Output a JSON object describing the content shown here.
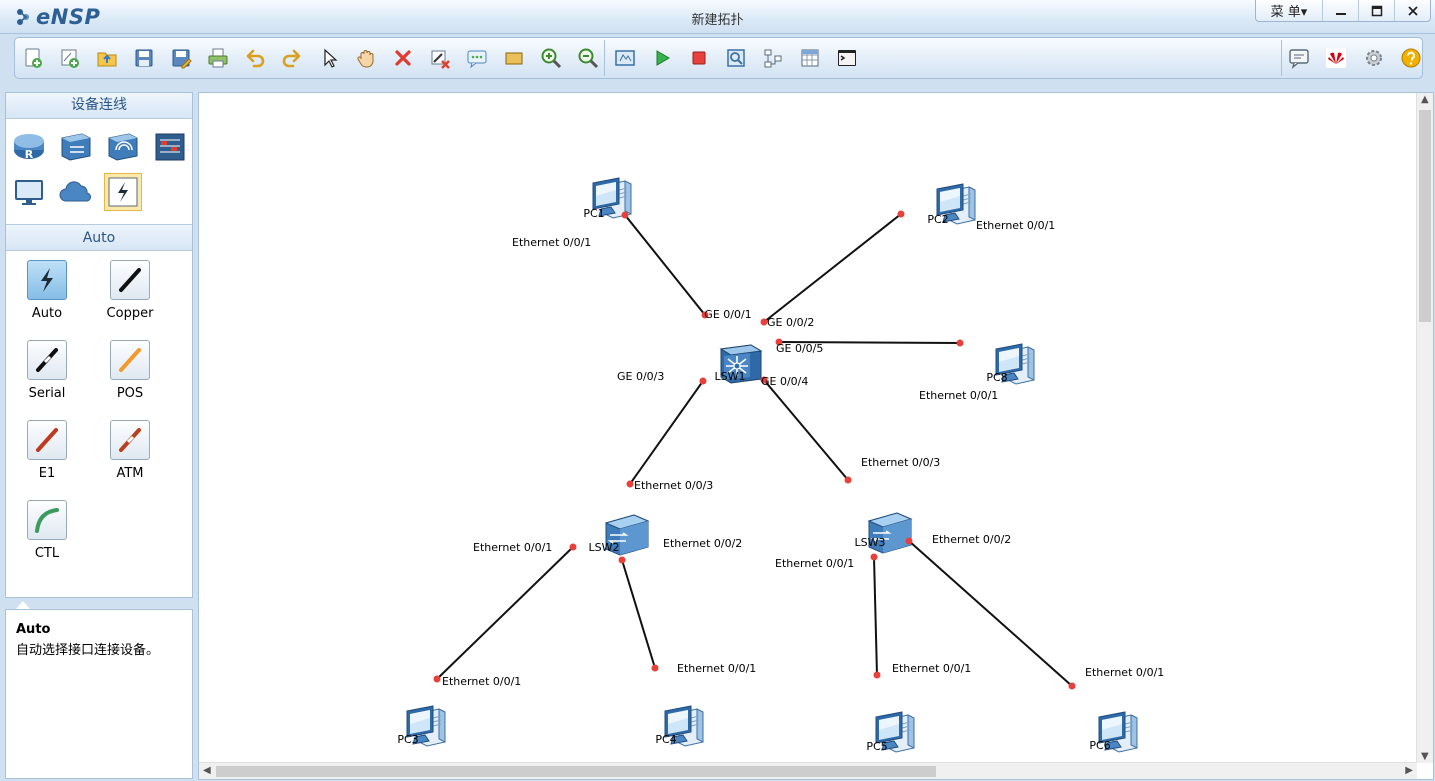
{
  "app": {
    "logo_text": "eNSP",
    "title": "新建拓扑",
    "menu_label": "菜 单▾"
  },
  "toolbar": {
    "left_icons": [
      "new-topology-icon",
      "new-lab-icon",
      "open-icon",
      "save-icon",
      "save-as-icon",
      "print-icon",
      "undo-icon",
      "redo-icon",
      "select-icon",
      "hand-pan-icon",
      "delete-icon",
      "delete-link-icon",
      "text-note-icon",
      "rectangle-icon",
      "zoom-in-icon",
      "zoom-out-icon",
      "fit-icon",
      "start-device-icon",
      "stop-device-icon",
      "capture-icon",
      "topology-icon",
      "grid-icon",
      "command-line-icon"
    ],
    "right_icons": [
      "chat-icon",
      "huawei-icon",
      "settings-icon",
      "help-icon"
    ]
  },
  "palette": {
    "header": "设备连线",
    "categories": [
      "router-icon",
      "switch-icon",
      "wlan-icon",
      "firewall-icon",
      "pc-icon",
      "cloud-icon",
      "connection-icon"
    ],
    "section": "Auto",
    "cables": [
      {
        "name": "Auto",
        "icon": "auto-cable-icon",
        "color": "#1d2b38"
      },
      {
        "name": "Copper",
        "icon": "copper-cable-icon",
        "color": "#111111"
      },
      {
        "name": "Serial",
        "icon": "serial-cable-icon",
        "color": "#111111"
      },
      {
        "name": "POS",
        "icon": "pos-cable-icon",
        "color": "#f39a2a"
      },
      {
        "name": "E1",
        "icon": "e1-cable-icon",
        "color": "#c0391f"
      },
      {
        "name": "ATM",
        "icon": "atm-cable-icon",
        "color": "#b8401c"
      },
      {
        "name": "CTL",
        "icon": "ctl-cable-icon",
        "color": "#3a9a5f"
      }
    ]
  },
  "description": {
    "title": "Auto",
    "text": "自动选择接口连接设备。"
  },
  "topology": {
    "devices": [
      {
        "id": "PC1",
        "label": "PC1",
        "type": "pc"
      },
      {
        "id": "PC2",
        "label": "PC2",
        "type": "pc"
      },
      {
        "id": "PC8",
        "label": "PC8",
        "type": "pc"
      },
      {
        "id": "LSW1",
        "label": "LSW1",
        "type": "core-switch"
      },
      {
        "id": "LSW2",
        "label": "LSW2",
        "type": "switch"
      },
      {
        "id": "LSW3",
        "label": "LSW3",
        "type": "switch"
      },
      {
        "id": "PC3",
        "label": "PC3",
        "type": "pc"
      },
      {
        "id": "PC4",
        "label": "PC4",
        "type": "pc"
      },
      {
        "id": "PC5",
        "label": "PC5",
        "type": "pc"
      },
      {
        "id": "PC6",
        "label": "PC6",
        "type": "pc"
      }
    ],
    "links": [
      {
        "a": "LSW1",
        "b": "PC1",
        "a_port": "GE 0/0/1",
        "b_port": "Ethernet 0/0/1"
      },
      {
        "a": "LSW1",
        "b": "PC2",
        "a_port": "GE 0/0/2",
        "b_port": "Ethernet 0/0/1"
      },
      {
        "a": "LSW1",
        "b": "PC8",
        "a_port": "GE 0/0/5",
        "b_port": "Ethernet 0/0/1"
      },
      {
        "a": "LSW1",
        "b": "LSW2",
        "a_port": "GE 0/0/3",
        "b_port": "Ethernet 0/0/3"
      },
      {
        "a": "LSW1",
        "b": "LSW3",
        "a_port": "GE 0/0/4",
        "b_port": "Ethernet 0/0/3"
      },
      {
        "a": "LSW2",
        "b": "PC3",
        "a_port": "Ethernet 0/0/1",
        "b_port": "Ethernet 0/0/1"
      },
      {
        "a": "LSW2",
        "b": "PC4",
        "a_port": "Ethernet 0/0/2",
        "b_port": "Ethernet 0/0/1"
      },
      {
        "a": "LSW3",
        "b": "PC5",
        "a_port": "Ethernet 0/0/1",
        "b_port": "Ethernet 0/0/1"
      },
      {
        "a": "LSW3",
        "b": "PC6",
        "a_port": "Ethernet 0/0/2",
        "b_port": "Ethernet 0/0/1"
      }
    ]
  }
}
